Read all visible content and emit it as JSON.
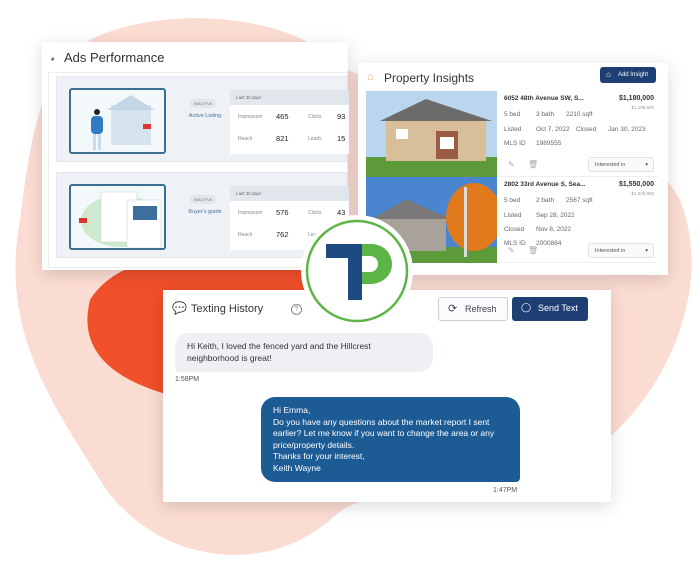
{
  "colors": {
    "brand": "#1d3f73",
    "accent_orange": "#f0502a",
    "blob_pink": "#fbdcd3",
    "logo_green": "#5cb646"
  },
  "ads": {
    "title": "Ads Performance",
    "items": [
      {
        "badge": "INACTIVE",
        "name": "Active Listing",
        "period": "Last 30 days",
        "impression_label": "Impression",
        "impression": "465",
        "clicks_label": "Clicks",
        "clicks": "93",
        "reach_label": "Reach",
        "reach": "821",
        "leads_label": "Leads",
        "leads": "15"
      },
      {
        "badge": "INACTIVE",
        "name": "Buyer's guide",
        "period": "Last 30 days",
        "impression_label": "Impression",
        "impression": "576",
        "clicks_label": "Clicks",
        "clicks": "43",
        "reach_label": "Reach",
        "reach": "762",
        "leads_label": "Leads",
        "leads": ""
      }
    ]
  },
  "property": {
    "title": "Property Insights",
    "add_label": "Add Insight",
    "items": [
      {
        "address": "6052 48th Avenue SW, S...",
        "price": "$1,180,000",
        "old_price": "$1,199,500",
        "beds": "5 bed",
        "baths": "3 bath",
        "sqft": "2210 sqft",
        "listed_label": "Listed",
        "listed": "Oct 7, 2022",
        "closed_label": "Closed",
        "closed": "Jan 30, 2023",
        "mls_label": "MLS ID",
        "mls": "1989555",
        "status": "Interested in"
      },
      {
        "address": "2802 33rd Avenue S, Sea...",
        "price": "$1,550,000",
        "old_price": "$1,549,950",
        "beds": "5 bed",
        "baths": "2 bath",
        "sqft": "2567 sqft",
        "listed_label": "Listed",
        "listed": "Sep 28, 2022",
        "closed_label": "Closed",
        "closed": "Nov 8, 2022",
        "mls_label": "MLS ID",
        "mls": "2000884",
        "status": "Interested in"
      }
    ]
  },
  "texting": {
    "title": "Texting History",
    "refresh_label": "Refresh",
    "send_label": "Send Text",
    "messages": [
      {
        "text": "Hi Keith, I loved the fenced yard and the Hillcrest neighborhood is great!",
        "time": "1:58PM"
      },
      {
        "text": "Hi Emma,\nDo you have any questions about the market report I sent earlier? Let me know if you want to change the area or any price/property details.\nThanks for your interest,\nKeith Wayne",
        "time": "1:47PM"
      }
    ]
  }
}
